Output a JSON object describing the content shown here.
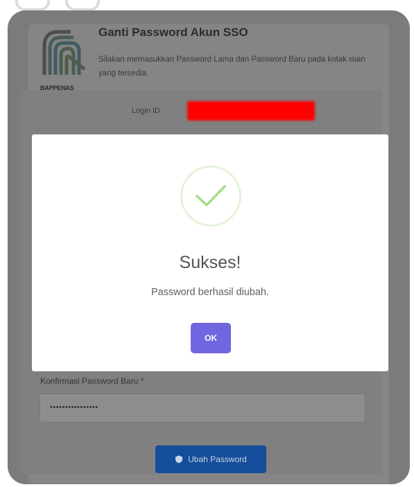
{
  "header": {
    "logo_text": "BAPPENAS",
    "title": "Ganti Password Akun SSO",
    "subtitle": "Silakan memasukkan Password Lama dan Password Baru pada kotak isian yang tersedia."
  },
  "form": {
    "login_label": "Login ID",
    "confirm_label": "Konfirmasi Password Baru *",
    "confirm_value": "••••••••••••••••",
    "submit_label": "Ubah Password"
  },
  "modal": {
    "title": "Sukses!",
    "message": "Password berhasil diubah.",
    "ok_label": "OK",
    "icon": "check-icon"
  },
  "colors": {
    "ok_button": "#7066e0",
    "submit_button": "#144d9a",
    "check": "#a5dc86",
    "redaction": "#ff0000"
  }
}
